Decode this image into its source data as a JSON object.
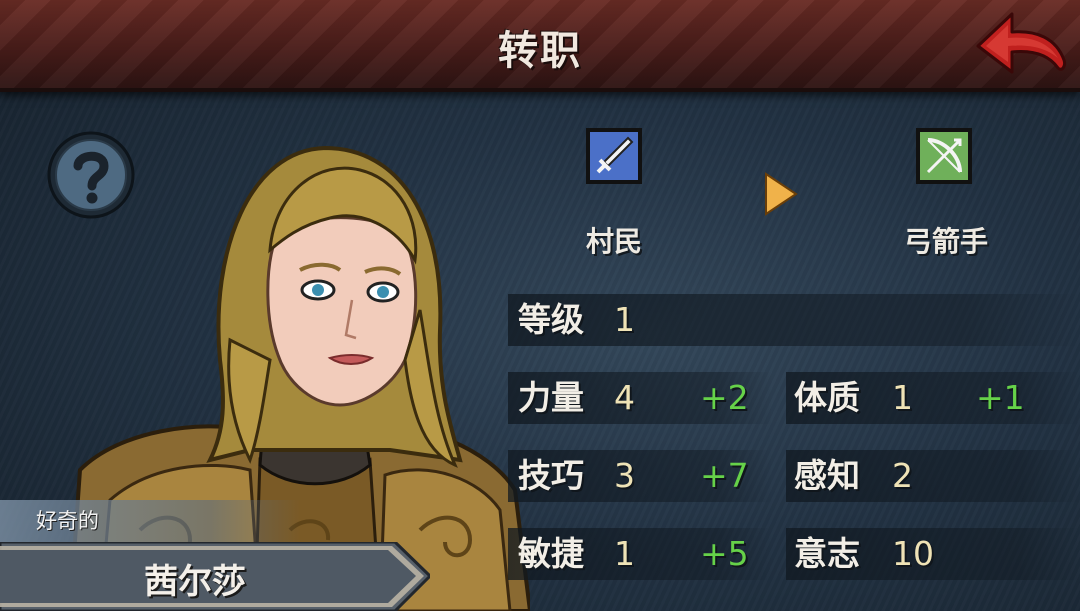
{
  "header": {
    "title": "转职"
  },
  "icons": {
    "back": "back-arrow-icon",
    "help": "question-mark-icon",
    "from_class": "sword-icon",
    "to_class": "bow-icon",
    "arrow": "triangle-right-icon"
  },
  "character": {
    "trait": "好奇的",
    "name": "茜尔莎"
  },
  "class_change": {
    "from": "村民",
    "to": "弓箭手"
  },
  "level": {
    "label": "等级",
    "value": "1"
  },
  "stats_left": [
    {
      "label": "力量",
      "value": "4",
      "bonus": "+2"
    },
    {
      "label": "技巧",
      "value": "3",
      "bonus": "+7"
    },
    {
      "label": "敏捷",
      "value": "1",
      "bonus": "+5"
    }
  ],
  "stats_right": [
    {
      "label": "体质",
      "value": "1",
      "bonus": "+1"
    },
    {
      "label": "感知",
      "value": "2",
      "bonus": ""
    },
    {
      "label": "意志",
      "value": "10",
      "bonus": ""
    }
  ],
  "colors": {
    "header": "#4a1d1a",
    "bonus": "#66d249",
    "value": "#efe3b6",
    "arrow": "#f0b24a",
    "back": "#b81f1f"
  }
}
